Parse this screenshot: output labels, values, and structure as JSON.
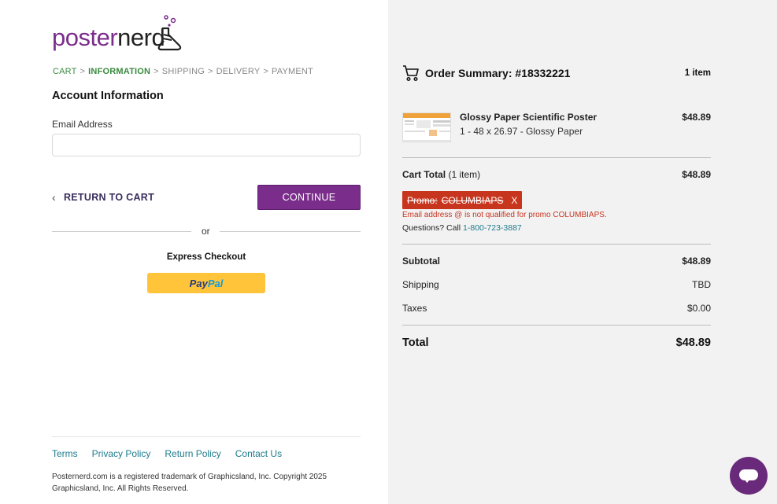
{
  "logo": {
    "word1": "poster",
    "word2": "nerd"
  },
  "breadcrumb": {
    "items": [
      "CART",
      "INFORMATION",
      "SHIPPING",
      "DELIVERY",
      "PAYMENT"
    ],
    "separator": ">"
  },
  "account": {
    "title": "Account Information",
    "email_label": "Email Address",
    "email_value": "",
    "email_placeholder": ""
  },
  "actions": {
    "return_label": "RETURN TO CART",
    "continue_label": "CONTINUE",
    "or_text": "or",
    "express_label": "Express Checkout",
    "paypal_part1": "Pay",
    "paypal_part2": "Pal"
  },
  "footer": {
    "links": [
      "Terms",
      "Privacy Policy",
      "Return Policy",
      "Contact Us"
    ],
    "copyright_line1": "Posternerd.com is a registered trademark of Graphicsland, Inc. Copyright 2025",
    "copyright_line2": "Graphicsland, Inc. All Rights Reserved."
  },
  "summary": {
    "title": "Order Summary: #18332221",
    "item_count": "1 item",
    "product": {
      "name": "Glossy Paper Scientific Poster",
      "desc": "1 - 48 x 26.97 - Glossy Paper",
      "price": "$48.89"
    },
    "cart_total_label": "Cart Total",
    "cart_total_count": "(1 item)",
    "cart_total_value": "$48.89",
    "promo_label": "Promo:",
    "promo_code": "COLUMBIAPS",
    "promo_remove": "X",
    "promo_error": "Email address @ is not qualified for promo COLUMBIAPS.",
    "questions_text": "Questions? Call",
    "phone": "1-800-723-3887",
    "subtotal_label": "Subtotal",
    "subtotal_value": "$48.89",
    "shipping_label": "Shipping",
    "shipping_value": "TBD",
    "taxes_label": "Taxes",
    "taxes_value": "$0.00",
    "total_label": "Total",
    "total_value": "$48.89"
  },
  "colors": {
    "brand_purple": "#7b2d8c",
    "link_teal": "#1e7c8c",
    "breadcrumb_green": "#3a8a3f",
    "promo_red": "#c8351f",
    "paypal_yellow": "#ffc439"
  }
}
